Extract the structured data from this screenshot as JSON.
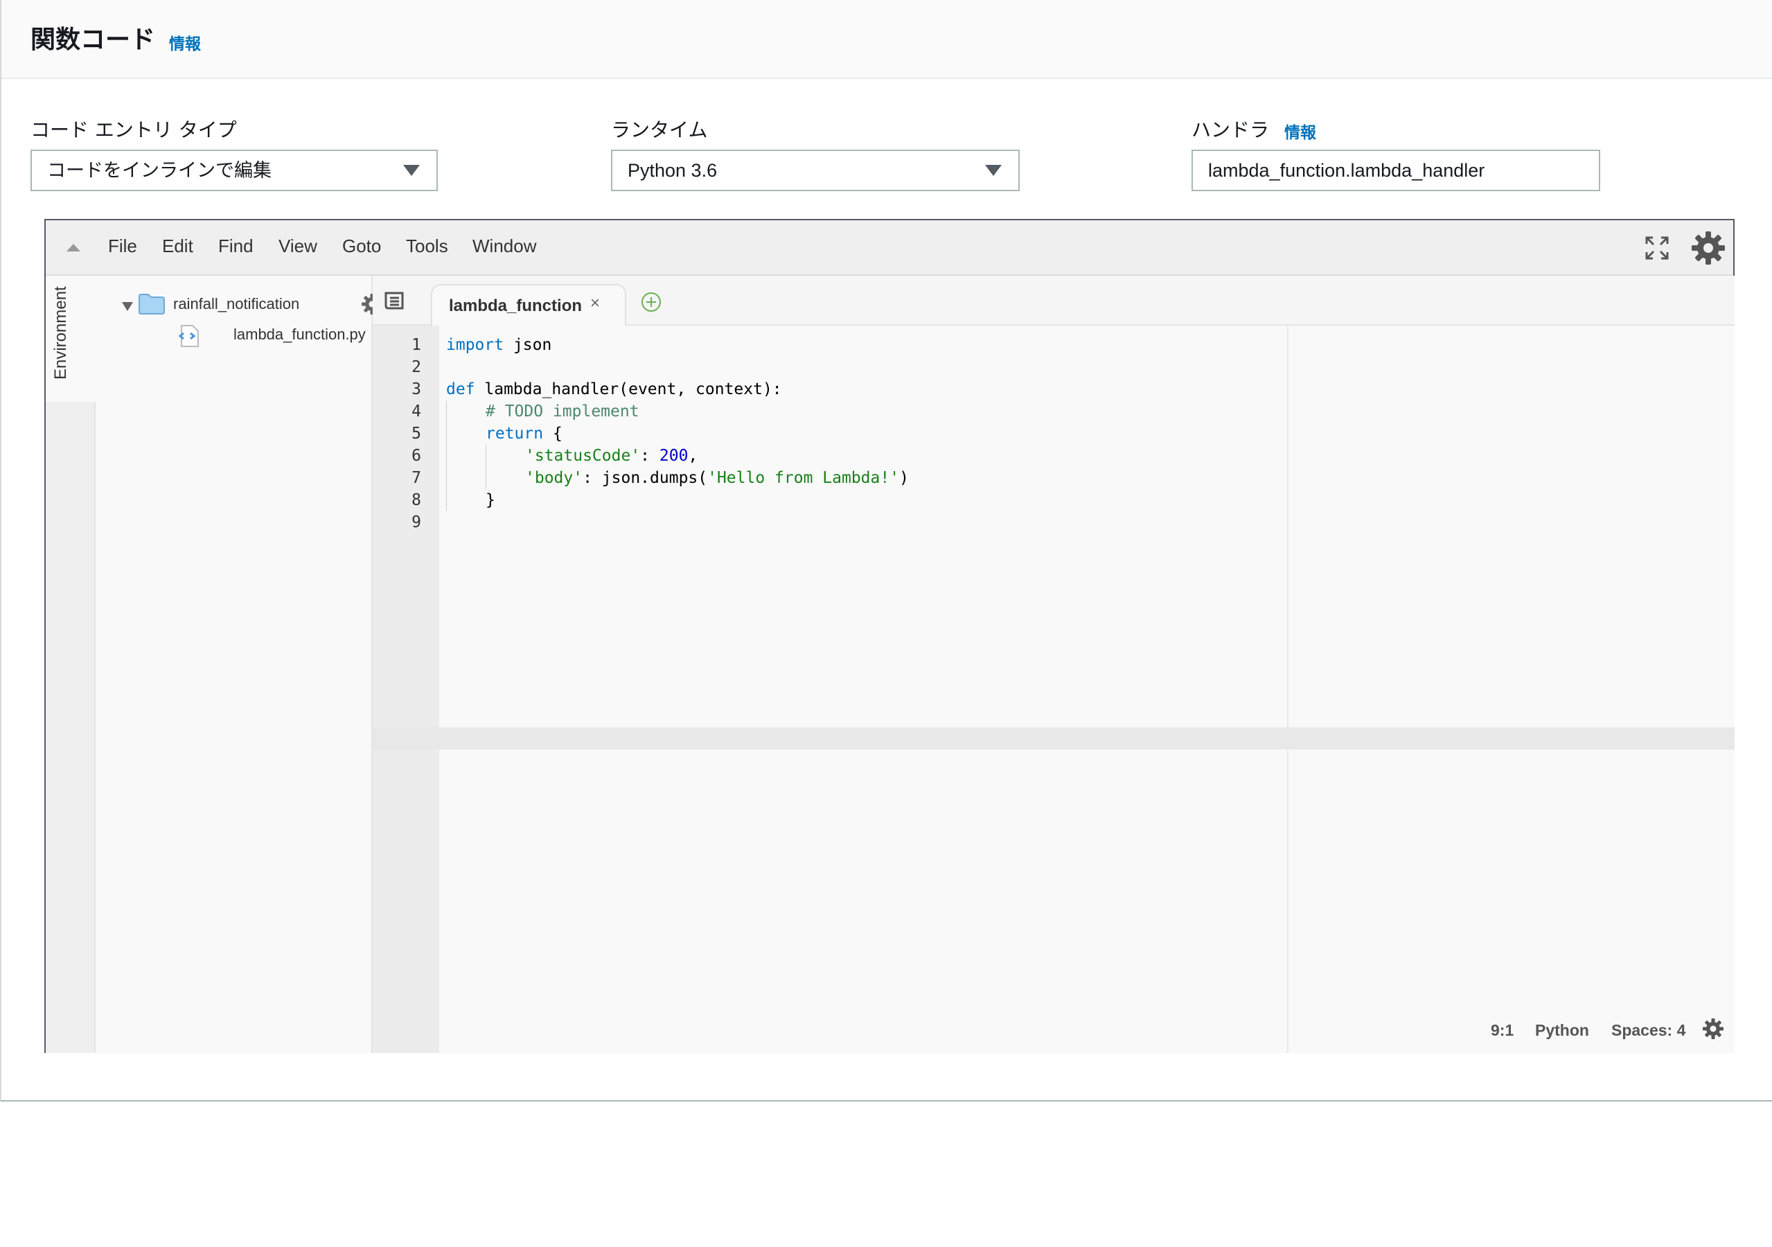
{
  "panel": {
    "title": "関数コード",
    "title_info": "情報"
  },
  "fields": {
    "code_entry": {
      "label": "コード エントリ タイプ",
      "value": "コードをインラインで編集"
    },
    "runtime": {
      "label": "ランタイム",
      "value": "Python 3.6"
    },
    "handler": {
      "label": "ハンドラ",
      "info": "情報",
      "value": "lambda_function.lambda_handler"
    }
  },
  "ide": {
    "menu": [
      "File",
      "Edit",
      "Find",
      "View",
      "Goto",
      "Tools",
      "Window"
    ],
    "env_label": "Environment",
    "tree": {
      "folder": "rainfall_notification",
      "file": "lambda_function.py"
    },
    "tab": {
      "label": "lambda_function",
      "close": "×"
    },
    "line_numbers": [
      "1",
      "2",
      "3",
      "4",
      "5",
      "6",
      "7",
      "8",
      "9"
    ],
    "code": {
      "l1_kw": "import",
      "l1_rest": " json",
      "l3_kw": "def",
      "l3_rest": " lambda_handler(event, context):",
      "l4_cmt": "# TODO implement",
      "l5_kw": "return",
      "l5_rest": " {",
      "l6_str": "'statusCode'",
      "l6_mid": ": ",
      "l6_num": "200",
      "l6_end": ",",
      "l7_str": "'body'",
      "l7_mid": ": json.dumps(",
      "l7_str2": "'Hello from Lambda!'",
      "l7_end": ")",
      "l8": "}"
    },
    "status": {
      "position": "9:1",
      "language": "Python",
      "spaces": "Spaces: 4"
    }
  },
  "icons": {
    "fullscreen": "fullscreen-icon",
    "settings": "gear-icon",
    "folder": "folder-icon",
    "file": "python-file-icon",
    "add_tab": "plus-circle-icon"
  }
}
